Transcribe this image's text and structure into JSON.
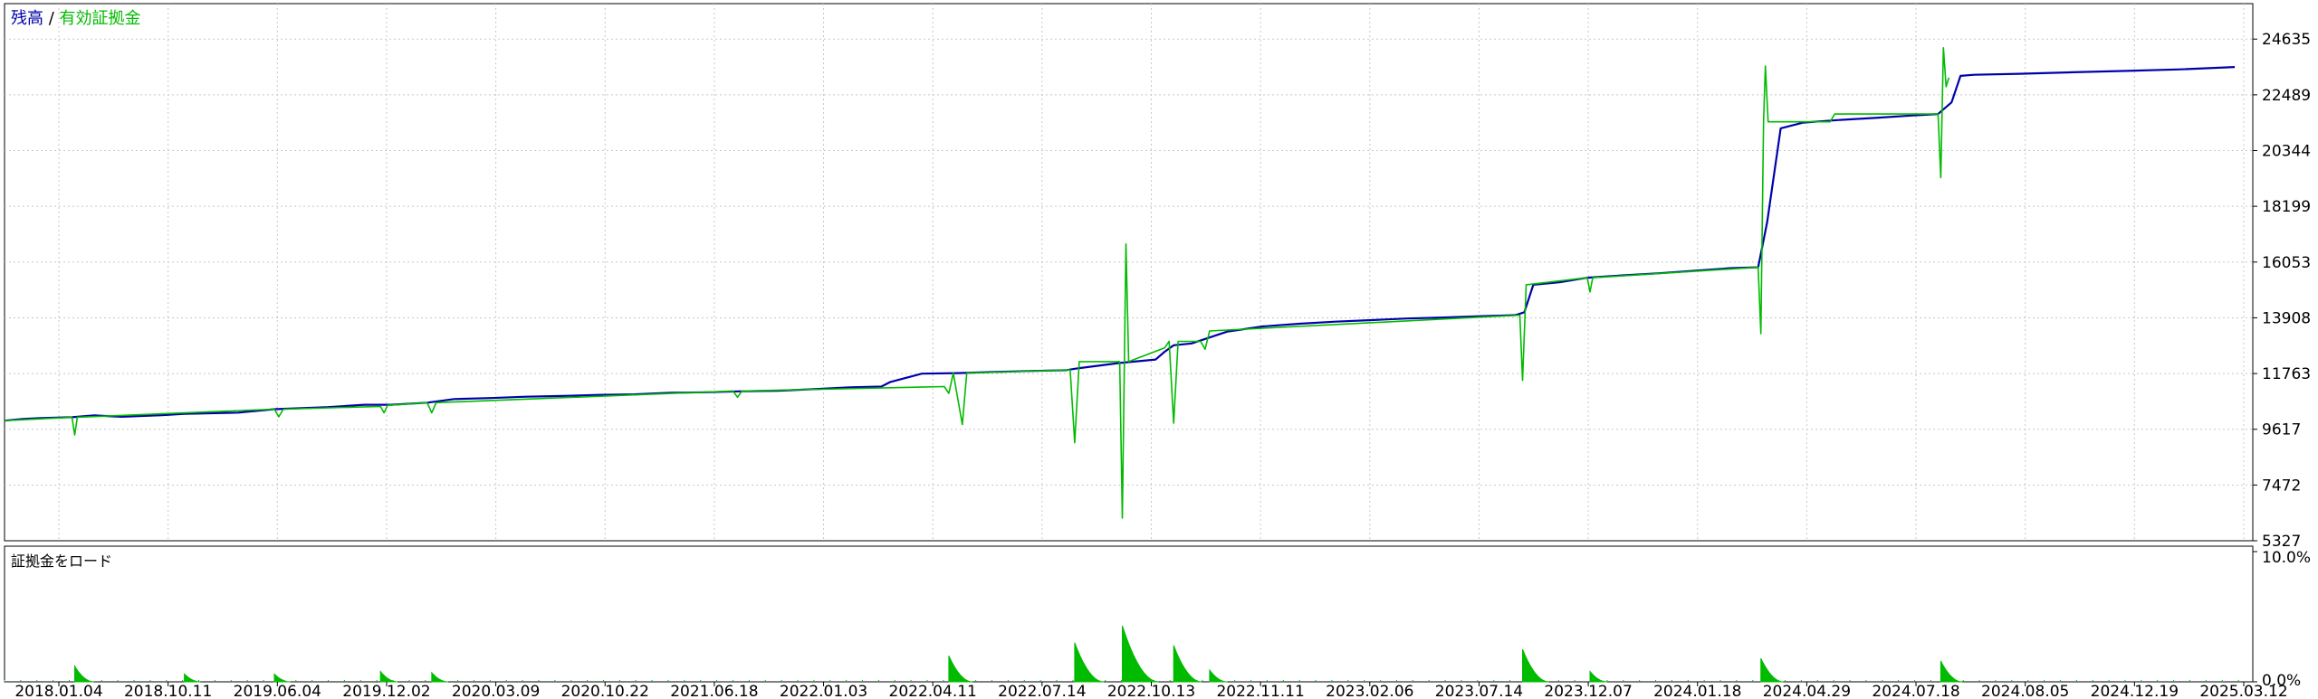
{
  "chart_data": [
    {
      "type": "line",
      "title_parts": [
        "残高",
        " / ",
        "有効証拠金"
      ],
      "series": [
        {
          "name": "残高",
          "color": "#0000aa",
          "points": [
            [
              0,
              9950
            ],
            [
              20,
              10010
            ],
            [
              40,
              10050
            ],
            [
              75,
              10080
            ],
            [
              100,
              10150
            ],
            [
              130,
              10100
            ],
            [
              175,
              10160
            ],
            [
              200,
              10210
            ],
            [
              260,
              10260
            ],
            [
              300,
              10390
            ],
            [
              330,
              10430
            ],
            [
              360,
              10470
            ],
            [
              400,
              10560
            ],
            [
              430,
              10560
            ],
            [
              470,
              10640
            ],
            [
              500,
              10780
            ],
            [
              540,
              10820
            ],
            [
              580,
              10870
            ],
            [
              620,
              10900
            ],
            [
              660,
              10940
            ],
            [
              700,
              10960
            ],
            [
              740,
              11020
            ],
            [
              780,
              11040
            ],
            [
              820,
              11080
            ],
            [
              860,
              11100
            ],
            [
              900,
              11160
            ],
            [
              940,
              11230
            ],
            [
              975,
              11260
            ],
            [
              985,
              11440
            ],
            [
              1020,
              11760
            ],
            [
              1060,
              11780
            ],
            [
              1100,
              11820
            ],
            [
              1140,
              11860
            ],
            [
              1180,
              11890
            ],
            [
              1195,
              11970
            ],
            [
              1240,
              12170
            ],
            [
              1280,
              12300
            ],
            [
              1290,
              12600
            ],
            [
              1300,
              12850
            ],
            [
              1320,
              12920
            ],
            [
              1360,
              13380
            ],
            [
              1400,
              13580
            ],
            [
              1440,
              13680
            ],
            [
              1480,
              13760
            ],
            [
              1520,
              13820
            ],
            [
              1560,
              13880
            ],
            [
              1600,
              13920
            ],
            [
              1640,
              13970
            ],
            [
              1680,
              14010
            ],
            [
              1690,
              14120
            ],
            [
              1700,
              15180
            ],
            [
              1730,
              15280
            ],
            [
              1760,
              15450
            ],
            [
              1800,
              15540
            ],
            [
              1840,
              15620
            ],
            [
              1880,
              15720
            ],
            [
              1920,
              15820
            ],
            [
              1950,
              15850
            ],
            [
              1960,
              17600
            ],
            [
              1975,
              21200
            ],
            [
              2000,
              21420
            ],
            [
              2040,
              21520
            ],
            [
              2080,
              21600
            ],
            [
              2120,
              21690
            ],
            [
              2150,
              21750
            ],
            [
              2165,
              22200
            ],
            [
              2175,
              23220
            ],
            [
              2190,
              23260
            ],
            [
              2240,
              23300
            ],
            [
              2300,
              23360
            ],
            [
              2360,
              23410
            ],
            [
              2420,
              23470
            ],
            [
              2480,
              23560
            ]
          ]
        },
        {
          "name": "有効証拠金",
          "color": "#00bb00",
          "points": [
            [
              0,
              9950
            ],
            [
              75,
              10080
            ],
            [
              78,
              9400
            ],
            [
              81,
              10080
            ],
            [
              300,
              10390
            ],
            [
              305,
              10100
            ],
            [
              310,
              10390
            ],
            [
              418,
              10500
            ],
            [
              422,
              10250
            ],
            [
              426,
              10540
            ],
            [
              470,
              10640
            ],
            [
              475,
              10250
            ],
            [
              480,
              10640
            ],
            [
              810,
              11090
            ],
            [
              815,
              10850
            ],
            [
              820,
              11090
            ],
            [
              1045,
              11260
            ],
            [
              1050,
              11000
            ],
            [
              1055,
              11780
            ],
            [
              1065,
              9800
            ],
            [
              1070,
              11780
            ],
            [
              1185,
              11900
            ],
            [
              1190,
              9100
            ],
            [
              1195,
              12220
            ],
            [
              1240,
              12220
            ],
            [
              1243,
              6200
            ],
            [
              1247,
              16750
            ],
            [
              1250,
              12220
            ],
            [
              1290,
              12750
            ],
            [
              1295,
              13000
            ],
            [
              1300,
              9850
            ],
            [
              1305,
              13000
            ],
            [
              1330,
              13000
            ],
            [
              1335,
              12700
            ],
            [
              1340,
              13400
            ],
            [
              1685,
              14010
            ],
            [
              1688,
              11500
            ],
            [
              1692,
              15180
            ],
            [
              1760,
              15450
            ],
            [
              1763,
              14900
            ],
            [
              1766,
              15450
            ],
            [
              1950,
              15850
            ],
            [
              1953,
              13300
            ],
            [
              1956,
              21500
            ],
            [
              1958,
              23600
            ],
            [
              1961,
              21450
            ],
            [
              2030,
              21450
            ],
            [
              2035,
              21750
            ],
            [
              2150,
              21750
            ],
            [
              2153,
              19300
            ],
            [
              2156,
              24300
            ],
            [
              2159,
              22800
            ],
            [
              2162,
              23150
            ]
          ]
        }
      ],
      "y_ticks": [
        "24635",
        "22489",
        "20344",
        "18199",
        "16053",
        "13908",
        "11763",
        "9617",
        "7472",
        "5327"
      ],
      "ylim": [
        5327,
        26000
      ],
      "grid": true,
      "legend_position": "top-left"
    },
    {
      "type": "area",
      "label": "証拠金をロード",
      "y_ticks": [
        "10.0%",
        "0.0%"
      ],
      "ylim": [
        0,
        10
      ],
      "color": "#00bb00",
      "spikes": [
        [
          78,
          1.2
        ],
        [
          200,
          0.6
        ],
        [
          300,
          0.6
        ],
        [
          418,
          0.8
        ],
        [
          475,
          0.7
        ],
        [
          1050,
          2.0
        ],
        [
          1190,
          3.0
        ],
        [
          1243,
          4.3
        ],
        [
          1300,
          2.8
        ],
        [
          1340,
          0.9
        ],
        [
          1688,
          2.5
        ],
        [
          1763,
          0.8
        ],
        [
          1953,
          1.8
        ],
        [
          2153,
          1.6
        ]
      ],
      "x_ticks": [
        "2018.01.04",
        "2018.10.11",
        "2019.06.04",
        "2019.12.02",
        "2020.03.09",
        "2020.10.22",
        "2021.06.18",
        "2022.01.03",
        "2022.04.11",
        "2022.07.14",
        "2022.10.13",
        "2022.11.11",
        "2023.02.06",
        "2023.07.14",
        "2023.12.07",
        "2024.01.18",
        "2024.04.29",
        "2024.07.18",
        "2024.08.05",
        "2024.12.19",
        "2025.03.12"
      ],
      "grid": true
    }
  ]
}
